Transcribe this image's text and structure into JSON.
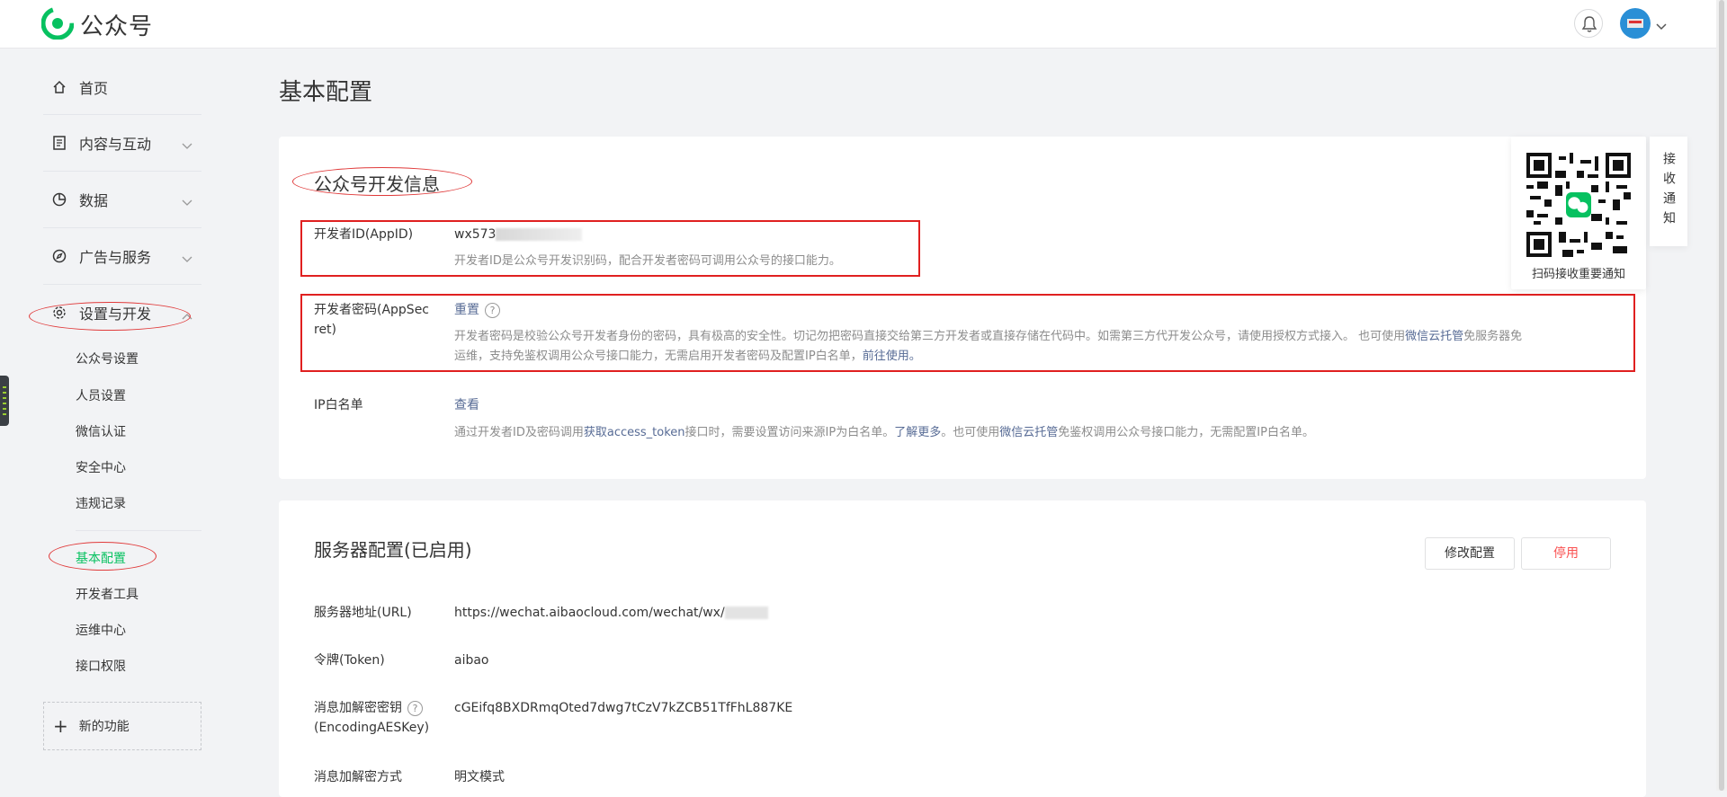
{
  "header": {
    "brand": "公众号"
  },
  "sidebar": {
    "items": [
      {
        "label": "首页"
      },
      {
        "label": "内容与互动"
      },
      {
        "label": "数据"
      },
      {
        "label": "广告与服务"
      },
      {
        "label": "设置与开发"
      }
    ],
    "sub_items": [
      {
        "label": "公众号设置"
      },
      {
        "label": "人员设置"
      },
      {
        "label": "微信认证"
      },
      {
        "label": "安全中心"
      },
      {
        "label": "违规记录"
      },
      {
        "label": "基本配置"
      },
      {
        "label": "开发者工具"
      },
      {
        "label": "运维中心"
      },
      {
        "label": "接口权限"
      }
    ],
    "new_features": "新的功能"
  },
  "main": {
    "page_title": "基本配置",
    "dev_info": {
      "title": "公众号开发信息",
      "appid_label": "开发者ID(AppID)",
      "appid_value": "wx573",
      "appid_desc": "开发者ID是公众号开发识别码，配合开发者密码可调用公众号的接口能力。",
      "secret_label_1": "开发者密码(AppSec",
      "secret_label_2": "ret)",
      "secret_action": "重置",
      "secret_desc_1": "开发者密码是校验公众号开发者身份的密码，具有极高的安全性。切记勿把密码直接交给第三方开发者或直接存储在代码中。如需第三方代开发公众号，请使用授权方式接入。 也可使用",
      "secret_desc_link_1": "微信云托管",
      "secret_desc_2": "免服务器免",
      "secret_desc_3": "运维，支持免鉴权调用公众号接口能力，无需启用开发者密码及配置IP白名单，",
      "secret_desc_link_2": "前往使用。",
      "ip_label": "IP白名单",
      "ip_action": "查看",
      "ip_desc_1": "通过开发者ID及密码调用",
      "ip_desc_link_1": "获取access_token",
      "ip_desc_2": "接口时，需要设置访问来源IP为白名单。",
      "ip_desc_link_2": "了解更多",
      "ip_desc_3": "。也可使用",
      "ip_desc_link_3": "微信云托管",
      "ip_desc_4": "免鉴权调用公众号接口能力，无需配置IP白名单。"
    },
    "server": {
      "title": "服务器配置(已启用)",
      "modify_button": "修改配置",
      "disable_button": "停用",
      "url_label": "服务器地址(URL)",
      "url_value": "https://wechat.aibaocloud.com/wechat/wx/",
      "token_label": "令牌(Token)",
      "token_value": "aibao",
      "aes_label_1": "消息加解密密钥",
      "aes_label_2": "(EncodingAESKey)",
      "aes_value": "cGEifq8BXDRmqOted7dwg7tCzV7kZCB51TfFhL887KE",
      "mode_label": "消息加解密方式",
      "mode_value": "明文模式"
    }
  },
  "qr_panel": {
    "caption": "扫码接收重要通知",
    "side_tab": "接收通知"
  },
  "colors": {
    "brand_green": "#07c160",
    "link_blue": "#576b95",
    "danger_red": "#fa5151",
    "annotation_red": "#e02020"
  }
}
